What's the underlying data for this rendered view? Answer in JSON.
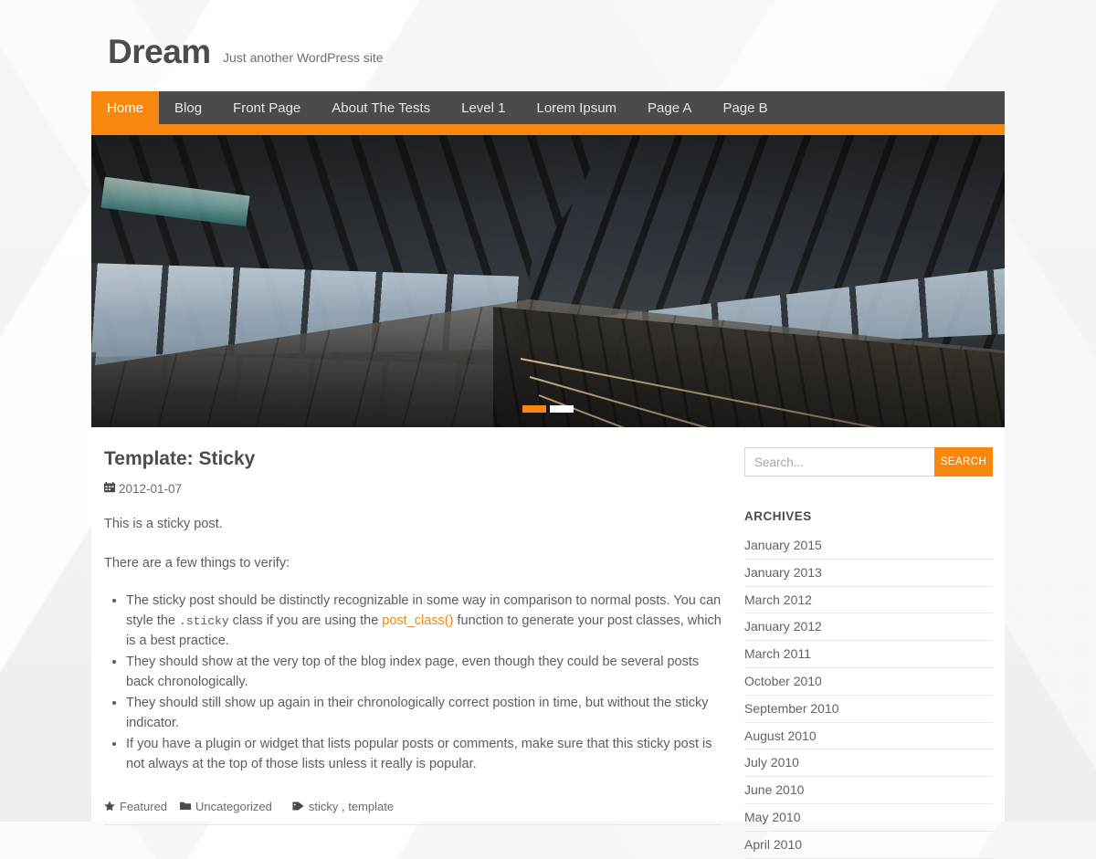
{
  "site": {
    "title": "Dream",
    "description": "Just another WordPress site"
  },
  "nav": {
    "items": [
      {
        "label": "Home",
        "active": true
      },
      {
        "label": "Blog",
        "active": false
      },
      {
        "label": "Front Page",
        "active": false
      },
      {
        "label": "About The Tests",
        "active": false
      },
      {
        "label": "Level 1",
        "active": false
      },
      {
        "label": "Lorem Ipsum",
        "active": false
      },
      {
        "label": "Page A",
        "active": false
      },
      {
        "label": "Page B",
        "active": false
      }
    ]
  },
  "hero": {
    "image_alt": "Railway station platform at sunset",
    "slides": [
      {
        "active": true
      },
      {
        "active": false
      }
    ]
  },
  "post": {
    "title": "Template: Sticky",
    "date_icon": "calendar-icon",
    "date": "2012-01-07",
    "paragraph_1": "This is a sticky post.",
    "paragraph_2": "There are a few things to verify:",
    "bullets": [
      {
        "part_1": "The sticky post should be distinctly recognizable in some way in comparison to normal posts. You can style the ",
        "code": ".sticky",
        "part_2": " class if you are using the ",
        "link": "post_class()",
        "part_3": " function to generate your post classes, which is a best practice."
      },
      {
        "text": "They should show at the very top of the blog index page, even though they could be several posts back chronologically."
      },
      {
        "text": "They should still show up again in their chronologically correct postion in time, but without the sticky indicator."
      },
      {
        "text": "If you have a plugin or widget that lists popular posts or comments, make sure that this sticky post is not always at the top of those lists unless it really is popular."
      }
    ],
    "footer": {
      "featured_icon": "star-icon",
      "featured_label": "Featured",
      "category_icon": "folder-icon",
      "category_label": "Uncategorized",
      "tag_icon": "tag-icon",
      "tags_label": "sticky , template"
    }
  },
  "sidebar": {
    "search": {
      "placeholder": "Search...",
      "value": "",
      "button_label": "SEARCH"
    },
    "archives": {
      "title": "ARCHIVES",
      "items": [
        "January 2015",
        "January 2013",
        "March 2012",
        "January 2012",
        "March 2011",
        "October 2010",
        "September 2010",
        "August 2010",
        "July 2010",
        "June 2010",
        "May 2010",
        "April 2010"
      ]
    }
  },
  "colors": {
    "accent": "#f7870f",
    "nav_background": "#4b4b4b",
    "text": "#5d5d5d",
    "heading": "#4c4c4c"
  }
}
